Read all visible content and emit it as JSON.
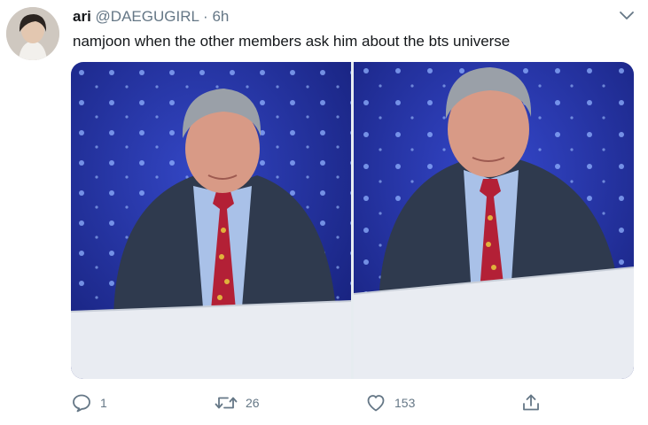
{
  "tweet": {
    "author_name": "ari",
    "handle": "@DAEGUGIRL",
    "separator": "·",
    "time": "6h",
    "text": "namjoon when the other members ask him about the bts universe"
  },
  "media": {
    "images": [
      {
        "icon": "photo-man-in-suit"
      },
      {
        "icon": "photo-man-in-suit-closeup"
      }
    ]
  },
  "actions": {
    "reply_count": "1",
    "retweet_count": "26",
    "like_count": "153"
  },
  "colors": {
    "text": "#14171a",
    "secondary": "#657786",
    "backdrop_blue": "#2434a8"
  }
}
